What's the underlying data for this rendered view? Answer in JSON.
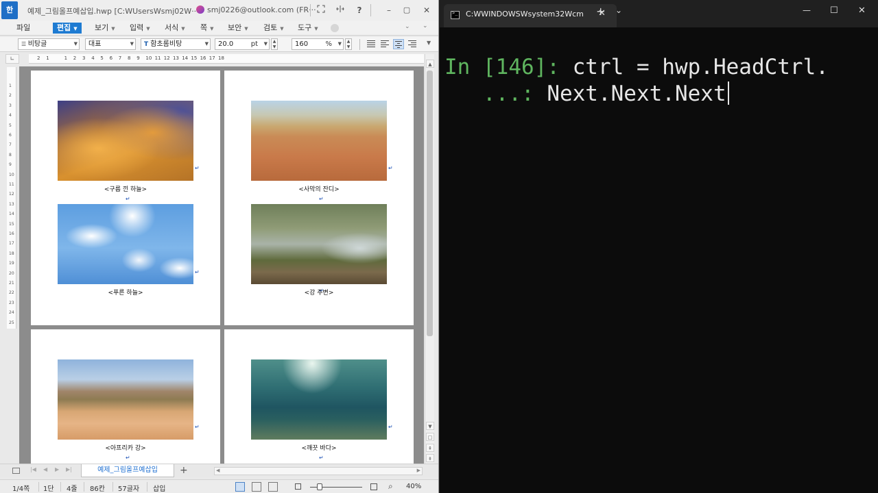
{
  "hwp": {
    "app_icon": "한",
    "title": "예제_그림올프예삽입.hwp [C:WUsersWsmj02W···",
    "account": "smj0226@outlook.com (FR···",
    "title_icons": [
      "expand-icon",
      "split-icon",
      "help-icon",
      "minimize-icon",
      "restore-icon",
      "close-icon"
    ],
    "title_glyphs": {
      "help": "?",
      "minimize": "–",
      "restore": "▢",
      "close": "✕"
    },
    "menu": {
      "file": "파일",
      "edit": "편집",
      "view": "보기",
      "insert": "입력",
      "format": "서식",
      "page": "쪽",
      "security": "보안",
      "review": "검토",
      "tools": "도구"
    },
    "format_bar": {
      "style": "비탕글",
      "lang": "대표",
      "font": "함초롬비탕",
      "size": "20.0",
      "size_unit": "pt",
      "zoom": "160",
      "zoom_unit": "%"
    },
    "ruler_numbers": [
      "2",
      "1",
      "",
      "1",
      "2",
      "3",
      "4",
      "5",
      "6",
      "7",
      "8",
      "9",
      "10",
      "11",
      "12",
      "13",
      "14",
      "15",
      "16",
      "17",
      "18"
    ],
    "vruler_numbers": [
      "1",
      "2",
      "3",
      "4",
      "5",
      "6",
      "7",
      "8",
      "9",
      "10",
      "11",
      "12",
      "13",
      "14",
      "15",
      "16",
      "17",
      "18",
      "19",
      "20",
      "21",
      "22",
      "23",
      "24",
      "25"
    ],
    "captions": [
      "<구름 낀 하늘>",
      "<사막의 잔디>",
      "<푸른 하늘>",
      "<강 주변>",
      "<아프리카 강>",
      "<깨끗 바다>"
    ],
    "return_mark": "↵",
    "tab": {
      "doc_name": "예제_그림올프예삽입",
      "add": "+"
    },
    "status": {
      "page": "1/4쪽",
      "column": "1단",
      "line": "4줄",
      "col": "86칸",
      "chars": "57글자",
      "mode": "삽입",
      "zoom": "40%"
    }
  },
  "terminal": {
    "tab_title": "C:WWINDOWSWsystem32Wcm",
    "tab_close": "✕",
    "new_tab": "+",
    "dropdown": "⌄",
    "controls": {
      "minimize": "—",
      "maximize": "☐",
      "close": "✕"
    },
    "line1_prompt": "In [146]:",
    "line1_code": " ctrl = hwp.HeadCtrl.",
    "line2_prompt": "   ...:",
    "line2_code": " Next.Next.Next"
  },
  "colors": {
    "accent": "#1e7bd2",
    "prompt_green": "#5fb55f",
    "terminal_bg": "#0c0c0c"
  }
}
